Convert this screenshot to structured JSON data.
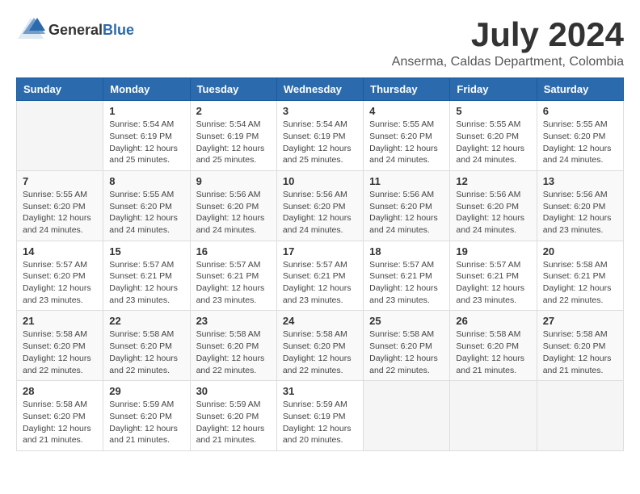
{
  "header": {
    "logo_general": "General",
    "logo_blue": "Blue",
    "month_year": "July 2024",
    "location": "Anserma, Caldas Department, Colombia"
  },
  "days_of_week": [
    "Sunday",
    "Monday",
    "Tuesday",
    "Wednesday",
    "Thursday",
    "Friday",
    "Saturday"
  ],
  "weeks": [
    [
      {
        "day": "",
        "info": ""
      },
      {
        "day": "1",
        "info": "Sunrise: 5:54 AM\nSunset: 6:19 PM\nDaylight: 12 hours\nand 25 minutes."
      },
      {
        "day": "2",
        "info": "Sunrise: 5:54 AM\nSunset: 6:19 PM\nDaylight: 12 hours\nand 25 minutes."
      },
      {
        "day": "3",
        "info": "Sunrise: 5:54 AM\nSunset: 6:19 PM\nDaylight: 12 hours\nand 25 minutes."
      },
      {
        "day": "4",
        "info": "Sunrise: 5:55 AM\nSunset: 6:20 PM\nDaylight: 12 hours\nand 24 minutes."
      },
      {
        "day": "5",
        "info": "Sunrise: 5:55 AM\nSunset: 6:20 PM\nDaylight: 12 hours\nand 24 minutes."
      },
      {
        "day": "6",
        "info": "Sunrise: 5:55 AM\nSunset: 6:20 PM\nDaylight: 12 hours\nand 24 minutes."
      }
    ],
    [
      {
        "day": "7",
        "info": "Sunrise: 5:55 AM\nSunset: 6:20 PM\nDaylight: 12 hours\nand 24 minutes."
      },
      {
        "day": "8",
        "info": "Sunrise: 5:55 AM\nSunset: 6:20 PM\nDaylight: 12 hours\nand 24 minutes."
      },
      {
        "day": "9",
        "info": "Sunrise: 5:56 AM\nSunset: 6:20 PM\nDaylight: 12 hours\nand 24 minutes."
      },
      {
        "day": "10",
        "info": "Sunrise: 5:56 AM\nSunset: 6:20 PM\nDaylight: 12 hours\nand 24 minutes."
      },
      {
        "day": "11",
        "info": "Sunrise: 5:56 AM\nSunset: 6:20 PM\nDaylight: 12 hours\nand 24 minutes."
      },
      {
        "day": "12",
        "info": "Sunrise: 5:56 AM\nSunset: 6:20 PM\nDaylight: 12 hours\nand 24 minutes."
      },
      {
        "day": "13",
        "info": "Sunrise: 5:56 AM\nSunset: 6:20 PM\nDaylight: 12 hours\nand 23 minutes."
      }
    ],
    [
      {
        "day": "14",
        "info": "Sunrise: 5:57 AM\nSunset: 6:20 PM\nDaylight: 12 hours\nand 23 minutes."
      },
      {
        "day": "15",
        "info": "Sunrise: 5:57 AM\nSunset: 6:21 PM\nDaylight: 12 hours\nand 23 minutes."
      },
      {
        "day": "16",
        "info": "Sunrise: 5:57 AM\nSunset: 6:21 PM\nDaylight: 12 hours\nand 23 minutes."
      },
      {
        "day": "17",
        "info": "Sunrise: 5:57 AM\nSunset: 6:21 PM\nDaylight: 12 hours\nand 23 minutes."
      },
      {
        "day": "18",
        "info": "Sunrise: 5:57 AM\nSunset: 6:21 PM\nDaylight: 12 hours\nand 23 minutes."
      },
      {
        "day": "19",
        "info": "Sunrise: 5:57 AM\nSunset: 6:21 PM\nDaylight: 12 hours\nand 23 minutes."
      },
      {
        "day": "20",
        "info": "Sunrise: 5:58 AM\nSunset: 6:21 PM\nDaylight: 12 hours\nand 22 minutes."
      }
    ],
    [
      {
        "day": "21",
        "info": "Sunrise: 5:58 AM\nSunset: 6:20 PM\nDaylight: 12 hours\nand 22 minutes."
      },
      {
        "day": "22",
        "info": "Sunrise: 5:58 AM\nSunset: 6:20 PM\nDaylight: 12 hours\nand 22 minutes."
      },
      {
        "day": "23",
        "info": "Sunrise: 5:58 AM\nSunset: 6:20 PM\nDaylight: 12 hours\nand 22 minutes."
      },
      {
        "day": "24",
        "info": "Sunrise: 5:58 AM\nSunset: 6:20 PM\nDaylight: 12 hours\nand 22 minutes."
      },
      {
        "day": "25",
        "info": "Sunrise: 5:58 AM\nSunset: 6:20 PM\nDaylight: 12 hours\nand 22 minutes."
      },
      {
        "day": "26",
        "info": "Sunrise: 5:58 AM\nSunset: 6:20 PM\nDaylight: 12 hours\nand 21 minutes."
      },
      {
        "day": "27",
        "info": "Sunrise: 5:58 AM\nSunset: 6:20 PM\nDaylight: 12 hours\nand 21 minutes."
      }
    ],
    [
      {
        "day": "28",
        "info": "Sunrise: 5:58 AM\nSunset: 6:20 PM\nDaylight: 12 hours\nand 21 minutes."
      },
      {
        "day": "29",
        "info": "Sunrise: 5:59 AM\nSunset: 6:20 PM\nDaylight: 12 hours\nand 21 minutes."
      },
      {
        "day": "30",
        "info": "Sunrise: 5:59 AM\nSunset: 6:20 PM\nDaylight: 12 hours\nand 21 minutes."
      },
      {
        "day": "31",
        "info": "Sunrise: 5:59 AM\nSunset: 6:19 PM\nDaylight: 12 hours\nand 20 minutes."
      },
      {
        "day": "",
        "info": ""
      },
      {
        "day": "",
        "info": ""
      },
      {
        "day": "",
        "info": ""
      }
    ]
  ]
}
